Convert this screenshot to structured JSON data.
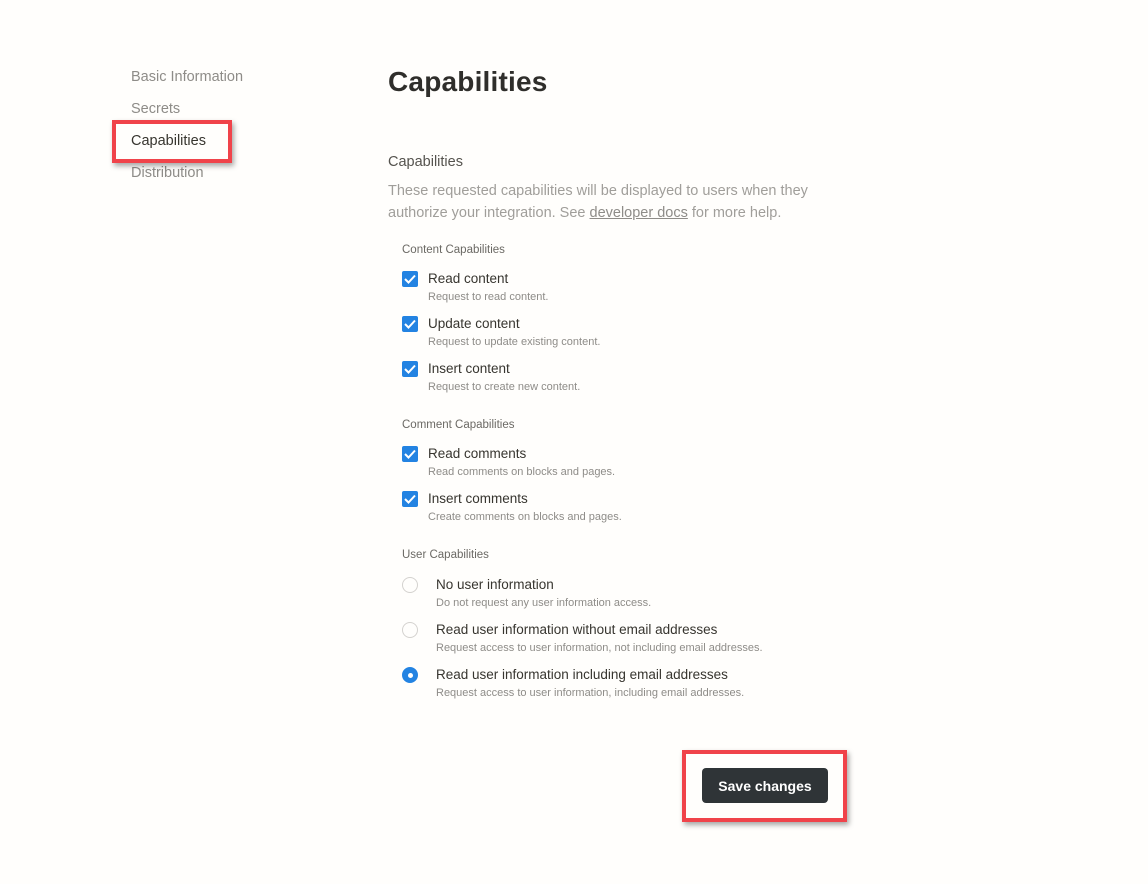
{
  "sidebar": {
    "items": [
      {
        "label": "Basic Information",
        "active": false
      },
      {
        "label": "Secrets",
        "active": false
      },
      {
        "label": "Capabilities",
        "active": true
      },
      {
        "label": "Distribution",
        "active": false
      }
    ]
  },
  "main": {
    "title": "Capabilities",
    "section": {
      "title": "Capabilities",
      "description_before": "These requested capabilities will be displayed to users when they authorize your integration. See ",
      "link_text": "developer docs",
      "description_after": " for more help."
    },
    "content_group": {
      "label": "Content Capabilities",
      "options": [
        {
          "label": "Read content",
          "description": "Request to read content.",
          "checked": true
        },
        {
          "label": "Update content",
          "description": "Request to update existing content.",
          "checked": true
        },
        {
          "label": "Insert content",
          "description": "Request to create new content.",
          "checked": true
        }
      ]
    },
    "comment_group": {
      "label": "Comment Capabilities",
      "options": [
        {
          "label": "Read comments",
          "description": "Read comments on blocks and pages.",
          "checked": true
        },
        {
          "label": "Insert comments",
          "description": "Create comments on blocks and pages.",
          "checked": true
        }
      ]
    },
    "user_group": {
      "label": "User Capabilities",
      "options": [
        {
          "label": "No user information",
          "description": "Do not request any user information access.",
          "selected": false
        },
        {
          "label": "Read user information without email addresses",
          "description": "Request access to user information, not including email addresses.",
          "selected": false
        },
        {
          "label": "Read user information including email addresses",
          "description": "Request access to user information, including email addresses.",
          "selected": true
        }
      ]
    },
    "save_label": "Save changes"
  },
  "colors": {
    "accent": "#2383e2",
    "highlight": "#f0434a",
    "button_bg": "#2f3437"
  }
}
